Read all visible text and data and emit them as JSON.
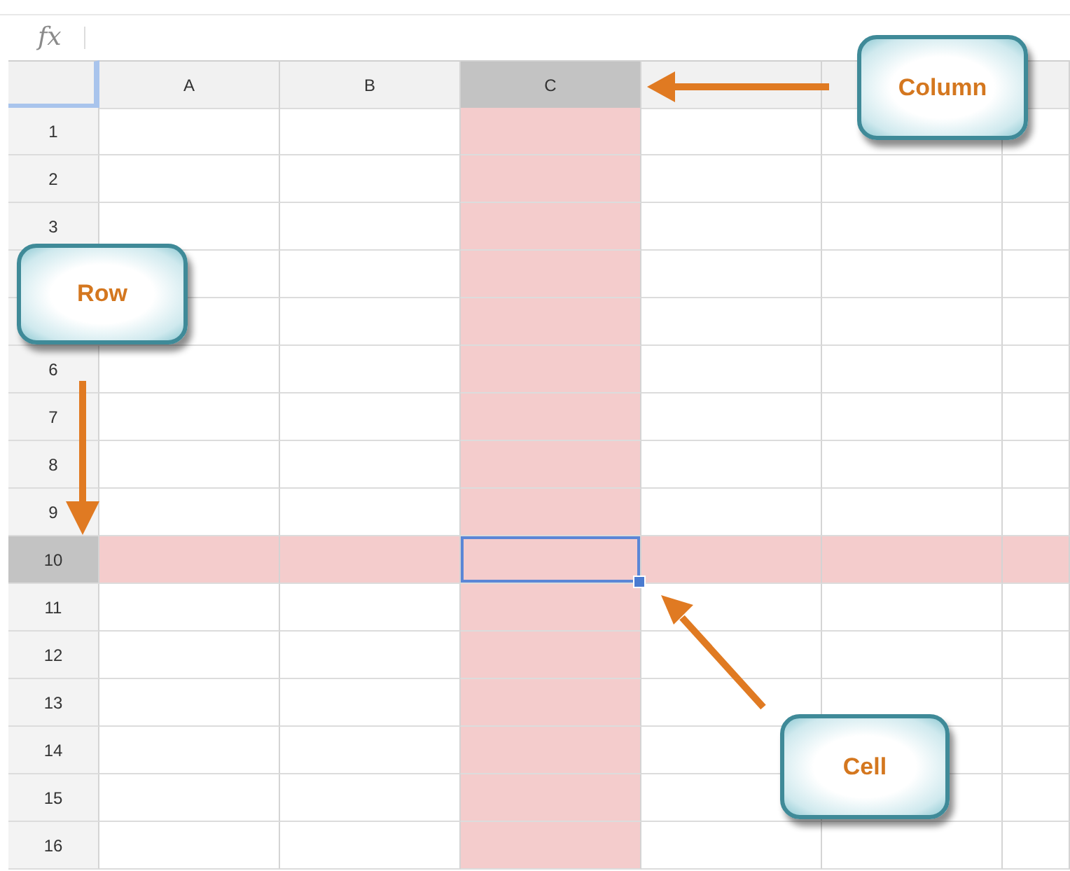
{
  "formula_bar": {
    "label": "fx"
  },
  "columns": [
    {
      "label": "A",
      "selected": false
    },
    {
      "label": "B",
      "selected": false
    },
    {
      "label": "C",
      "selected": true
    },
    {
      "selected": false
    },
    {
      "selected": false
    },
    {
      "selected": false
    }
  ],
  "rows": [
    {
      "number": "1",
      "selected": false
    },
    {
      "number": "2",
      "selected": false
    },
    {
      "number": "3",
      "selected": false
    },
    {
      "selected": false
    },
    {
      "selected": false
    },
    {
      "number": "6",
      "selected": false
    },
    {
      "number": "7",
      "selected": false
    },
    {
      "number": "8",
      "selected": false
    },
    {
      "number": "9",
      "selected": false
    },
    {
      "number": "10",
      "selected": true
    },
    {
      "number": "11",
      "selected": false
    },
    {
      "number": "12",
      "selected": false
    },
    {
      "number": "13",
      "selected": false
    },
    {
      "number": "14",
      "selected": false
    },
    {
      "number": "15",
      "selected": false
    },
    {
      "number": "16",
      "selected": false
    }
  ],
  "callouts": [
    {
      "kind": "column",
      "label": "Column"
    },
    {
      "kind": "row",
      "label": "Row"
    },
    {
      "kind": "cell",
      "label": "Cell"
    }
  ]
}
